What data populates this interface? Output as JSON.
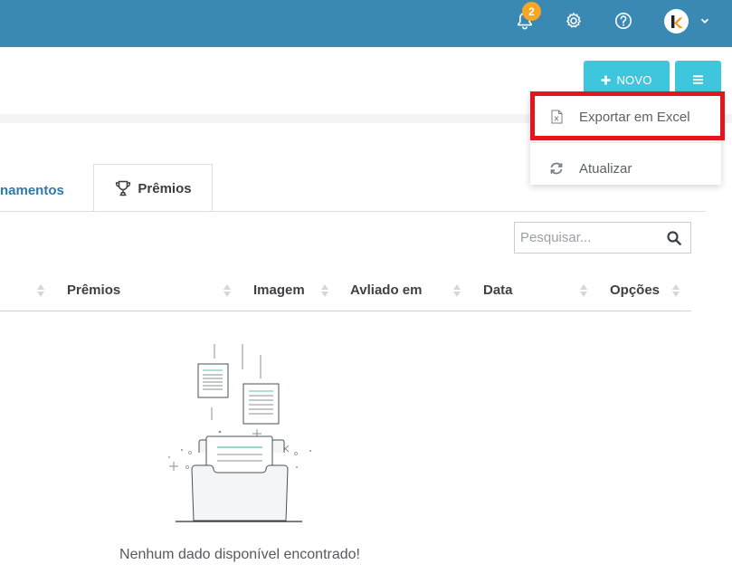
{
  "topbar": {
    "notification_count": "2",
    "bell_icon": "bell-icon",
    "settings_icon": "gear-icon",
    "help_icon": "help-icon",
    "avatar_letter": "k",
    "dropdown_icon": "chevron-down-icon",
    "color": "#3a88b4"
  },
  "toolbar": {
    "novo_label": "NOVO",
    "novo_icon": "plus-icon",
    "menu_icon": "hamburger-icon",
    "accent": "#3ec6dd"
  },
  "dropdown_menu": {
    "items": [
      {
        "label": "Exportar em Excel",
        "icon": "excel-file-icon"
      },
      {
        "label": "Atualizar",
        "icon": "refresh-icon"
      }
    ]
  },
  "tabs": [
    {
      "label": "namentos",
      "active": false
    },
    {
      "label": "Prêmios",
      "active": true,
      "icon": "trophy-icon"
    }
  ],
  "search": {
    "placeholder": "Pesquisar..."
  },
  "table": {
    "columns": [
      "Prêmios",
      "Imagem",
      "Avliado em",
      "Data",
      "Opções"
    ]
  },
  "empty_state": {
    "message": "Nenhum dado disponível encontrado!"
  },
  "highlight_color": "#e3161e"
}
